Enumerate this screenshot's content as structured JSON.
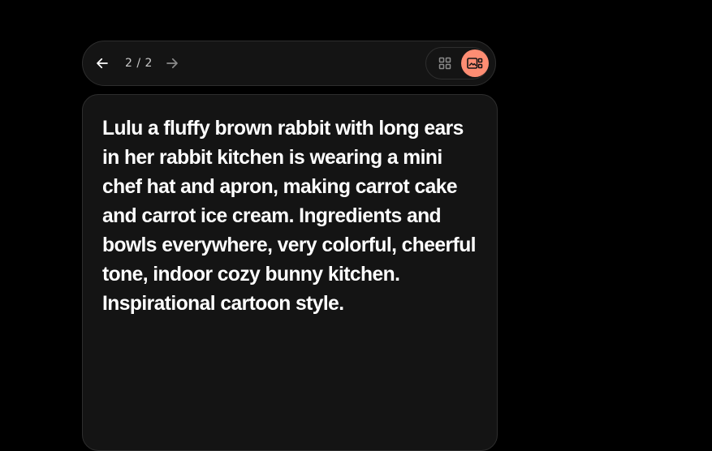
{
  "toolbar": {
    "back_icon": "arrow-left-icon",
    "forward_icon": "arrow-right-icon",
    "page_indicator": "2 / 2",
    "view_toggle": {
      "grid_icon": "grid-view-icon",
      "detail_icon": "image-detail-icon",
      "active": "detail"
    }
  },
  "prompt": {
    "text": "Lulu a fluffy brown rabbit with long ears in her rabbit kitchen is wearing a mini chef hat and apron, making carrot cake and carrot ice cream. Ingredients and bowls everywhere, very colorful, cheerful tone, indoor cozy bunny kitchen. Inspirational cartoon style."
  },
  "colors": {
    "background": "#000000",
    "surface": "#141414",
    "border": "#2e2e2e",
    "accent": "#ff8d73",
    "text_primary": "#ffffff",
    "text_secondary": "#c8c8c8",
    "icon_disabled": "#8a8a8a"
  }
}
